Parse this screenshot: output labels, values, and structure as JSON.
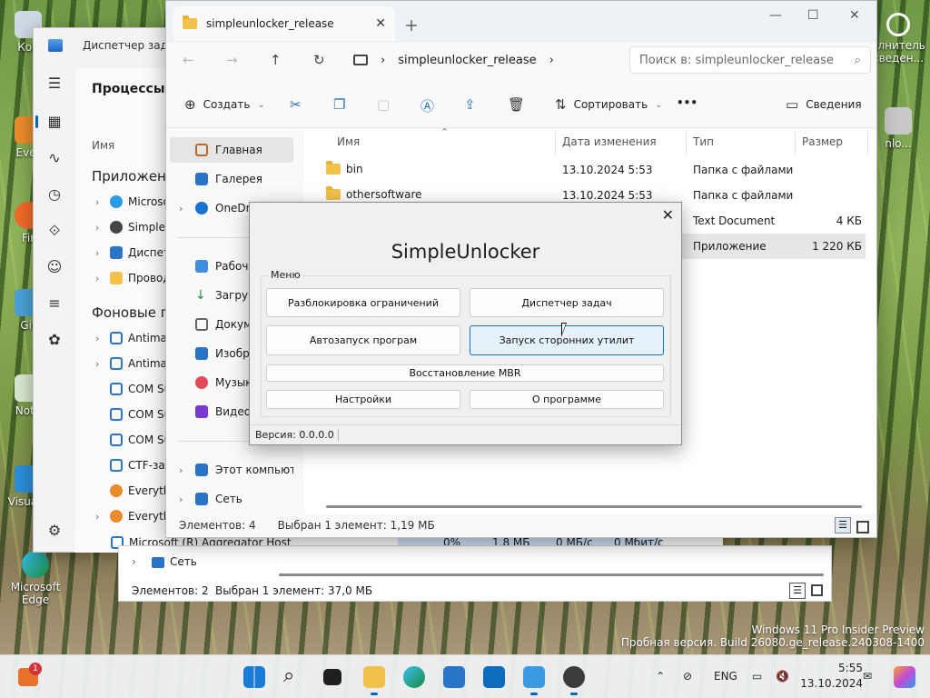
{
  "desktop": {
    "icons": [
      "Кор",
      "Ever",
      "Fir",
      "Git",
      "Note",
      "Visua C",
      "Microsoft Edge"
    ],
    "right_icons": [
      "олнитель сведен...",
      "nlo..."
    ]
  },
  "watermark": {
    "line1": "Windows 11 Pro Insider Preview",
    "line2": "Пробная версия. Build 26080.ge_release.240308-1400"
  },
  "task_manager": {
    "title": "Диспетчер задач",
    "heading": "Процессы",
    "col_name": "Имя",
    "section_apps": "Приложения",
    "section_bg": "Фоновые пр",
    "apps": [
      "Microso",
      "SimpleU",
      "Диспет",
      "Провод"
    ],
    "bg": [
      "Antimal",
      "Antimal",
      "COM Su",
      "COM Su",
      "COM Su",
      "CTF-за",
      "Everyth",
      "Everyth"
    ],
    "bottom_row": {
      "name": "Microsoft (R) Aggregator Host",
      "cpu": "0%",
      "mem": "1,8 МБ",
      "disk": "0 МБ/с",
      "net": "0 Мбит/с"
    }
  },
  "explorer2": {
    "side_item": "Сеть",
    "status_items": "Элементов: 2",
    "status_selected": "Выбран 1 элемент: 37,0 МБ"
  },
  "explorer": {
    "tab_title": "simpleunlocker_release",
    "path": "simpleunlocker_release",
    "search_placeholder": "Поиск в: simpleunlocker_release",
    "toolbar": {
      "create": "Создать",
      "sort": "Сортировать",
      "more": "•••",
      "details": "Сведения"
    },
    "sidebar": [
      "Главная",
      "Галерея",
      "OneDri",
      "Рабоч",
      "Загруз",
      "Докум",
      "Изобр",
      "Музык",
      "Видео",
      "Этот компьюте",
      "Сеть"
    ],
    "columns": {
      "name": "Имя",
      "date": "Дата изменения",
      "type": "Тип",
      "size": "Размер"
    },
    "files": [
      {
        "name": "bin",
        "date": "13.10.2024 5:53",
        "type": "Папка с файлами",
        "size": ""
      },
      {
        "name": "othersoftware",
        "date": "13.10.2024 5:53",
        "type": "Папка с файлами",
        "size": ""
      },
      {
        "name": "",
        "date": "",
        "type": "Text Document",
        "size": "4 КБ"
      },
      {
        "name": "",
        "date": "",
        "type": "Приложение",
        "size": "1 220 КБ"
      }
    ],
    "status_items": "Элементов: 4",
    "status_selected": "Выбран 1 элемент: 1,19 МБ"
  },
  "dialog": {
    "title": "SimpleUnlocker",
    "group": "Меню",
    "buttons": {
      "unlock": "Разблокировка ограничений",
      "taskmgr": "Диспетчер задач",
      "autorun": "Автозапуск програм",
      "thirdparty": "Запуск сторонних утилит",
      "mbr": "Восстановление MBR",
      "settings": "Настройки",
      "about": "О программе"
    },
    "version": "Версия: 0.0.0.0"
  },
  "taskbar": {
    "badge": "1",
    "lang": "ENG",
    "time": "5:55",
    "date": "13.10.2024"
  }
}
